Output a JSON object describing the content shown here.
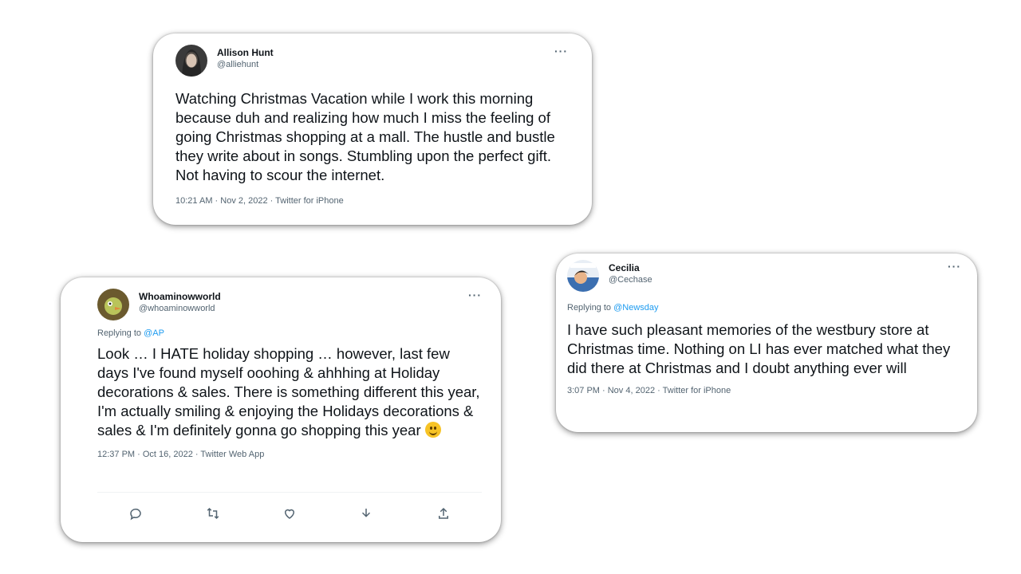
{
  "tweets": [
    {
      "display_name": "Allison Hunt",
      "handle": "@alliehunt",
      "more": "···",
      "text": "Watching Christmas Vacation while I work this morning because duh and realizing how much I miss the feeling of going Christmas shopping at a mall. The hustle and bustle they write about in songs. Stumbling upon the perfect gift. Not having to scour the internet.",
      "meta": "10:21 AM · Nov 2, 2022 · Twitter for iPhone"
    },
    {
      "display_name": "Whoaminowworld",
      "handle": "@whoaminowworld",
      "more": "···",
      "replying_prefix": "Replying to ",
      "replying_to": "@AP",
      "text": "Look … I HATE holiday shopping … however, last few days I've found myself ooohing & ahhhing at Holiday decorations & sales. There is something different this year, I'm actually smiling & enjoying the Holidays decorations & sales & I'm definitely gonna go shopping this year",
      "meta": "12:37 PM · Oct 16, 2022 · Twitter Web App",
      "actions": [
        "reply-icon",
        "retweet-icon",
        "like-icon",
        "bookmark-icon",
        "share-icon"
      ]
    },
    {
      "display_name": "Cecilia",
      "handle": "@Cechase",
      "more": "···",
      "replying_prefix": "Replying to ",
      "replying_to": "@Newsday",
      "text": "I have such pleasant memories of the westbury store at Christmas time. Nothing on LI has ever matched what they did there at Christmas and I doubt anything ever will",
      "meta": "3:07 PM · Nov 4, 2022 · Twitter for iPhone"
    }
  ],
  "colors": {
    "link": "#1d9bf0",
    "muted": "#536471",
    "text": "#0f1419"
  }
}
